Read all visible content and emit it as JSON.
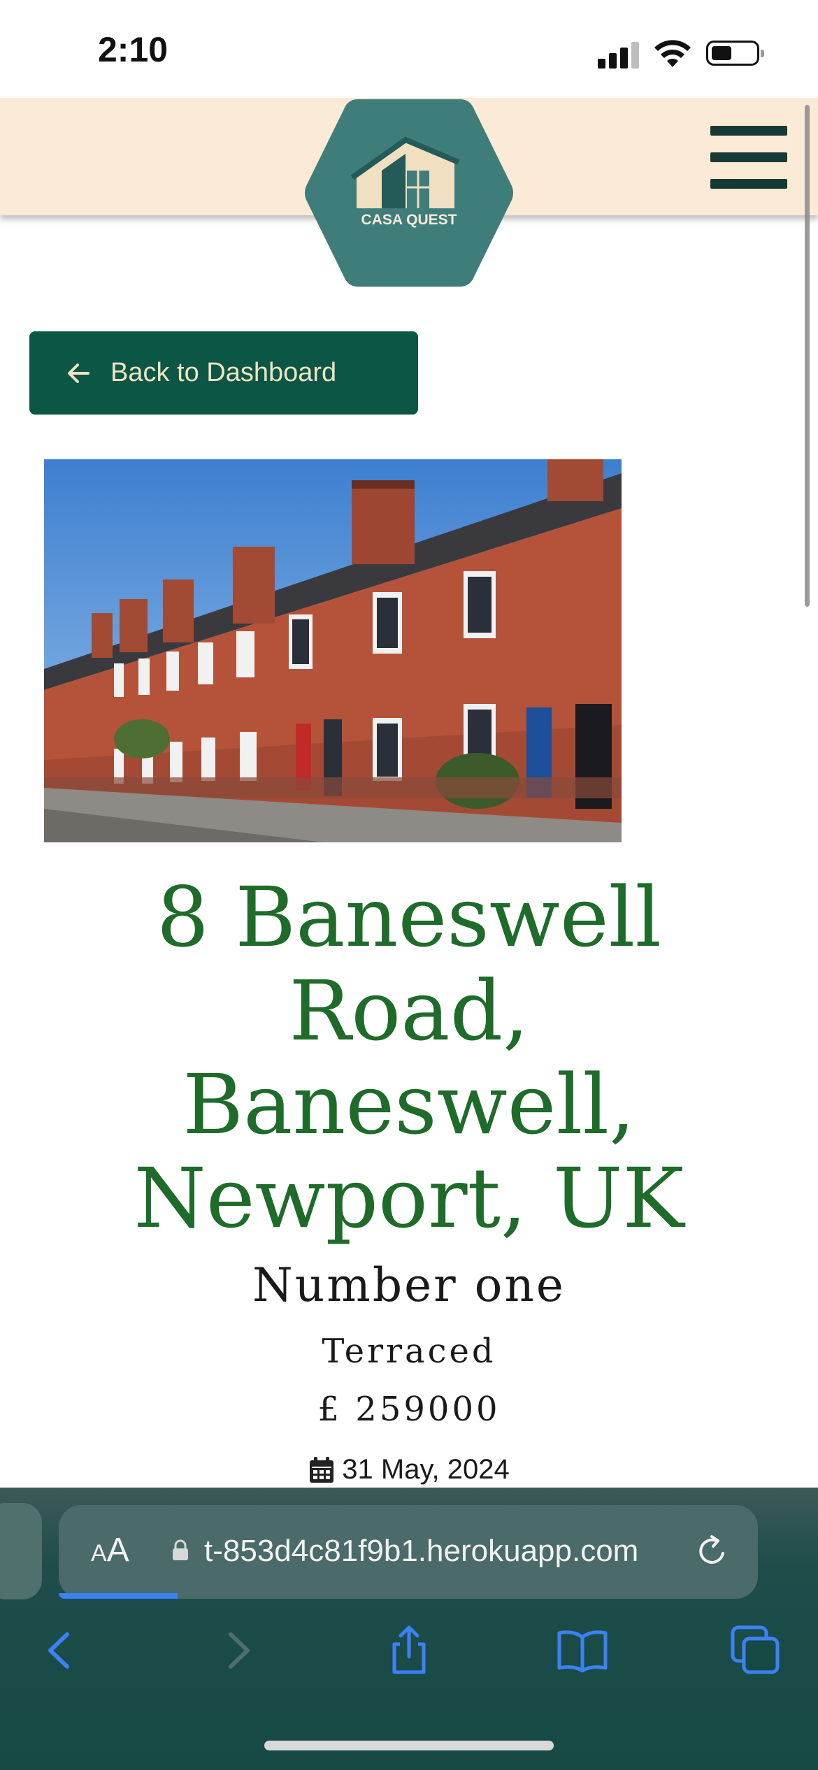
{
  "status_bar": {
    "time": "2:10"
  },
  "header": {
    "logo_text": "CASA QUEST",
    "menu_icon": "hamburger-menu-icon"
  },
  "back_button": {
    "label": "Back to Dashboard",
    "icon": "arrow-left-icon"
  },
  "property": {
    "image_alt": "Terraced red-brick houses",
    "address": "8 Baneswell Road, Baneswell, Newport, UK",
    "name": "Number one",
    "type": "Terraced",
    "price": "£ 259000",
    "date": "31 May, 2024",
    "date_icon": "calendar-icon"
  },
  "browser": {
    "aa_label_small": "A",
    "aa_label_large": "A",
    "url": "t-853d4c81f9b1.herokuapp.com",
    "toolbar_icons": [
      "back-icon",
      "forward-icon",
      "share-icon",
      "bookmarks-icon",
      "tabs-icon"
    ]
  },
  "colors": {
    "header_bg": "#fbead6",
    "logo_hex": "#3f7d7a",
    "button_bg": "#0b5645",
    "button_text": "#f2e3c3",
    "title_green": "#1f6b2a",
    "browser_bg": "#1e4d4a",
    "accent_blue": "#3b82f6"
  }
}
